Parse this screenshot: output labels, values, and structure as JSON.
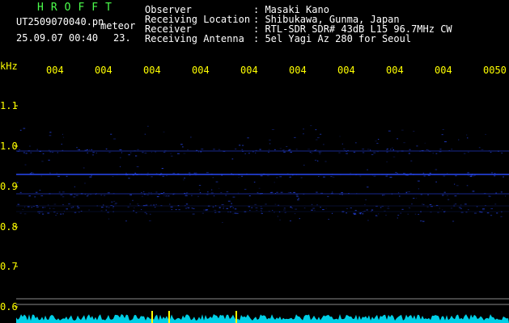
{
  "header": {
    "brand": "HROFFT",
    "filename": "UT2509070040.pn",
    "mode": "meteor",
    "date_time": "25.09.07 00:40",
    "counter": "23.",
    "info": [
      {
        "label": "Observer",
        "value": ": Masaki Kano"
      },
      {
        "label": "Receiving Location",
        "value": ": Shibukawa, Gunma, Japan"
      },
      {
        "label": "Receiver",
        "value": ": RTL-SDR SDR# 43dB L15 96.7MHz CW"
      },
      {
        "label": "Receiving Antenna",
        "value": ": 5el Yagi Az 280 for Seoul"
      }
    ]
  },
  "time_axis": {
    "labels": [
      "004",
      "004",
      "004",
      "004",
      "004",
      "004",
      "004",
      "004",
      "004",
      "0050"
    ]
  },
  "freq_axis": {
    "unit": "kHz",
    "labels": [
      "1.1",
      "1.0",
      "0.9",
      "0.8",
      "0.7",
      "0.6"
    ]
  },
  "colors": {
    "background": "#000000",
    "signal": "#2a4cff",
    "axis_text": "#ffff00",
    "header_text": "#ffffff",
    "brand": "#4cff4c",
    "noise_floor": "#00e5ff"
  }
}
